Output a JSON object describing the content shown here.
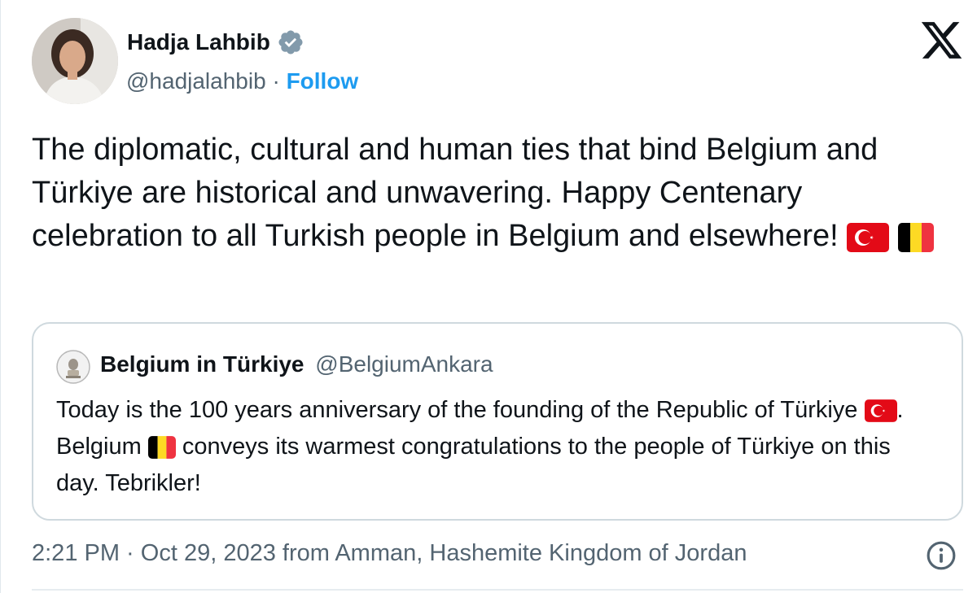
{
  "author": {
    "name": "Hadja Lahbib",
    "handle": "@hadjalahbib",
    "separator": " · ",
    "follow_label": "Follow",
    "verified_icon": "verified-badge-icon"
  },
  "platform_icon": "x-logo-icon",
  "tweet": {
    "text": "The diplomatic, cultural and human ties that bind Belgium and Türkiye are historical and unwavering. Happy Centenary celebration to all Turkish people in Belgium and elsewhere! ",
    "flags": [
      "turkey-flag-icon",
      "belgium-flag-icon"
    ]
  },
  "quote": {
    "name": "Belgium in Türkiye",
    "handle": "@BelgiumAnkara",
    "text_part1": "Today is the 100 years anniversary of the founding of the Republic of Türkiye ",
    "text_part2": ". Belgium ",
    "text_part3": " conveys its warmest congratulations to the people of Türkiye on this day. Tebrikler!"
  },
  "footer": {
    "meta": "2:21 PM · Oct 29, 2023 from Amman, Hashemite Kingdom of Jordan",
    "info_icon": "info-icon"
  },
  "colors": {
    "accent": "#1d9bf0",
    "secondary_text": "#536471",
    "border": "#cfd9de",
    "turkey_red": "#e30a17",
    "belgium_black": "#000000",
    "belgium_yellow": "#fdda24",
    "belgium_red": "#ef3340"
  }
}
